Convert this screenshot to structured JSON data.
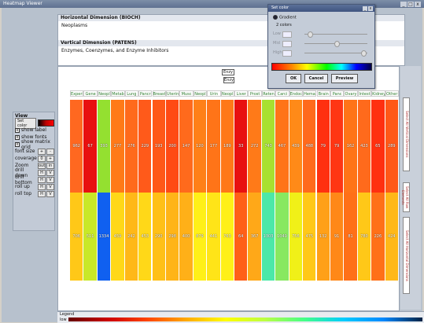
{
  "window": {
    "title": "Heatmap Viewer",
    "controls": [
      "_",
      "□",
      "x"
    ]
  },
  "info": {
    "horizontal_header": "Horizontal Dimension (BIOCH)",
    "horizontal_value": "Neoplasms",
    "vertical_header": "Vertical Dimension (PATENS)",
    "vertical_value": "Enzymes, Coenzymes, and Enzyme Inhibitors"
  },
  "main": {
    "top_label": "Enzy",
    "mid_label": "Enzy"
  },
  "left_panel": {
    "title": "View",
    "set_color_label": "Set color",
    "checkboxes": [
      {
        "label": "show label",
        "checked": "x"
      },
      {
        "label": "show fonts",
        "checked": "x"
      },
      {
        "label": "show matrix grid",
        "checked": "x"
      }
    ],
    "font_size": {
      "label": "font size",
      "btns": [
        "+",
        "-"
      ]
    },
    "coverage": {
      "label": "coverage",
      "value": "0",
      "btn": "+"
    },
    "zoom": {
      "label": "Zoom",
      "btns": [
        "out",
        "in"
      ]
    },
    "nav_rows": [
      {
        "label": "drill down",
        "btns": [
          "H",
          "V"
        ]
      },
      {
        "label": "drill bottom",
        "btns": [
          "H",
          "V"
        ]
      },
      {
        "label": "roll up",
        "btns": [
          "H",
          "V"
        ]
      },
      {
        "label": "roll top",
        "btns": [
          "H",
          "V"
        ]
      }
    ]
  },
  "columns": [
    "Experi",
    "Gene",
    "Neopl",
    "Metab",
    "Lung",
    "Pancr",
    "Breast",
    "Uterin",
    "Musc",
    "Neopl",
    "Urin",
    "Neopl",
    "Liver",
    "Prost",
    "Reten",
    "Carci",
    "Endoc",
    "Hemat",
    "Brain",
    "Panc",
    "Ovary",
    "Intest",
    "Kidney",
    "Other"
  ],
  "rows": [
    {
      "colors": [
        "#ff6820",
        "#e81010",
        "#94e030",
        "#ff7a18",
        "#ff6a1c",
        "#ff5a1a",
        "#ff5818",
        "#ff4a14",
        "#ff6a1c",
        "#ff8018",
        "#ff7418",
        "#ff7818",
        "#e81010",
        "#ff7a18",
        "#a8e030",
        "#ff7418",
        "#ff8a18",
        "#ff6a1c",
        "#ff3010",
        "#ff3614",
        "#ff7418",
        "#ff6a1c",
        "#ff3010",
        "#ff5818"
      ],
      "values": [
        "962",
        "67",
        "393",
        "277",
        "276",
        "229",
        "193",
        "200",
        "147",
        "120",
        "177",
        "189",
        "33",
        "272",
        "743",
        "467",
        "439",
        "488",
        "79",
        "79",
        "162",
        "423",
        "65",
        "289"
      ]
    },
    {
      "colors": [
        "#ffc818",
        "#c8e828",
        "#1060f0",
        "#ffd818",
        "#ffb818",
        "#ffd818",
        "#ffc018",
        "#ffb418",
        "#ffb018",
        "#fff018",
        "#ffe418",
        "#fff018",
        "#ff6018",
        "#ffa818",
        "#4ce8a8",
        "#88e860",
        "#f0f018",
        "#ffc818",
        "#ffa018",
        "#ff8818",
        "#ff7018",
        "#ffc818",
        "#ff7018",
        "#ffb818"
      ],
      "values": [
        "706",
        "511",
        "1334",
        "459",
        "242",
        "453",
        "290",
        "298",
        "400",
        "879",
        "441",
        "763",
        "64",
        "367",
        "1303",
        "1049",
        "756",
        "475",
        "132",
        "91",
        "81",
        "780",
        "226",
        "424"
      ]
    }
  ],
  "right_panel": [
    "Select All Vertical Dimensions",
    "Select All Row Elements",
    "Select All Horizontal Dimensions"
  ],
  "legend": {
    "label": "Legend",
    "min_label": "low"
  },
  "dialog": {
    "title": "Set color",
    "radio_option": "Gradient",
    "sub_option": "2 colors",
    "slider_labels": [
      "Low",
      "Mid",
      "High"
    ],
    "slider_levels": [
      0.05,
      0.5,
      0.95
    ],
    "buttons": [
      "OK",
      "Cancel",
      "Preview"
    ]
  }
}
